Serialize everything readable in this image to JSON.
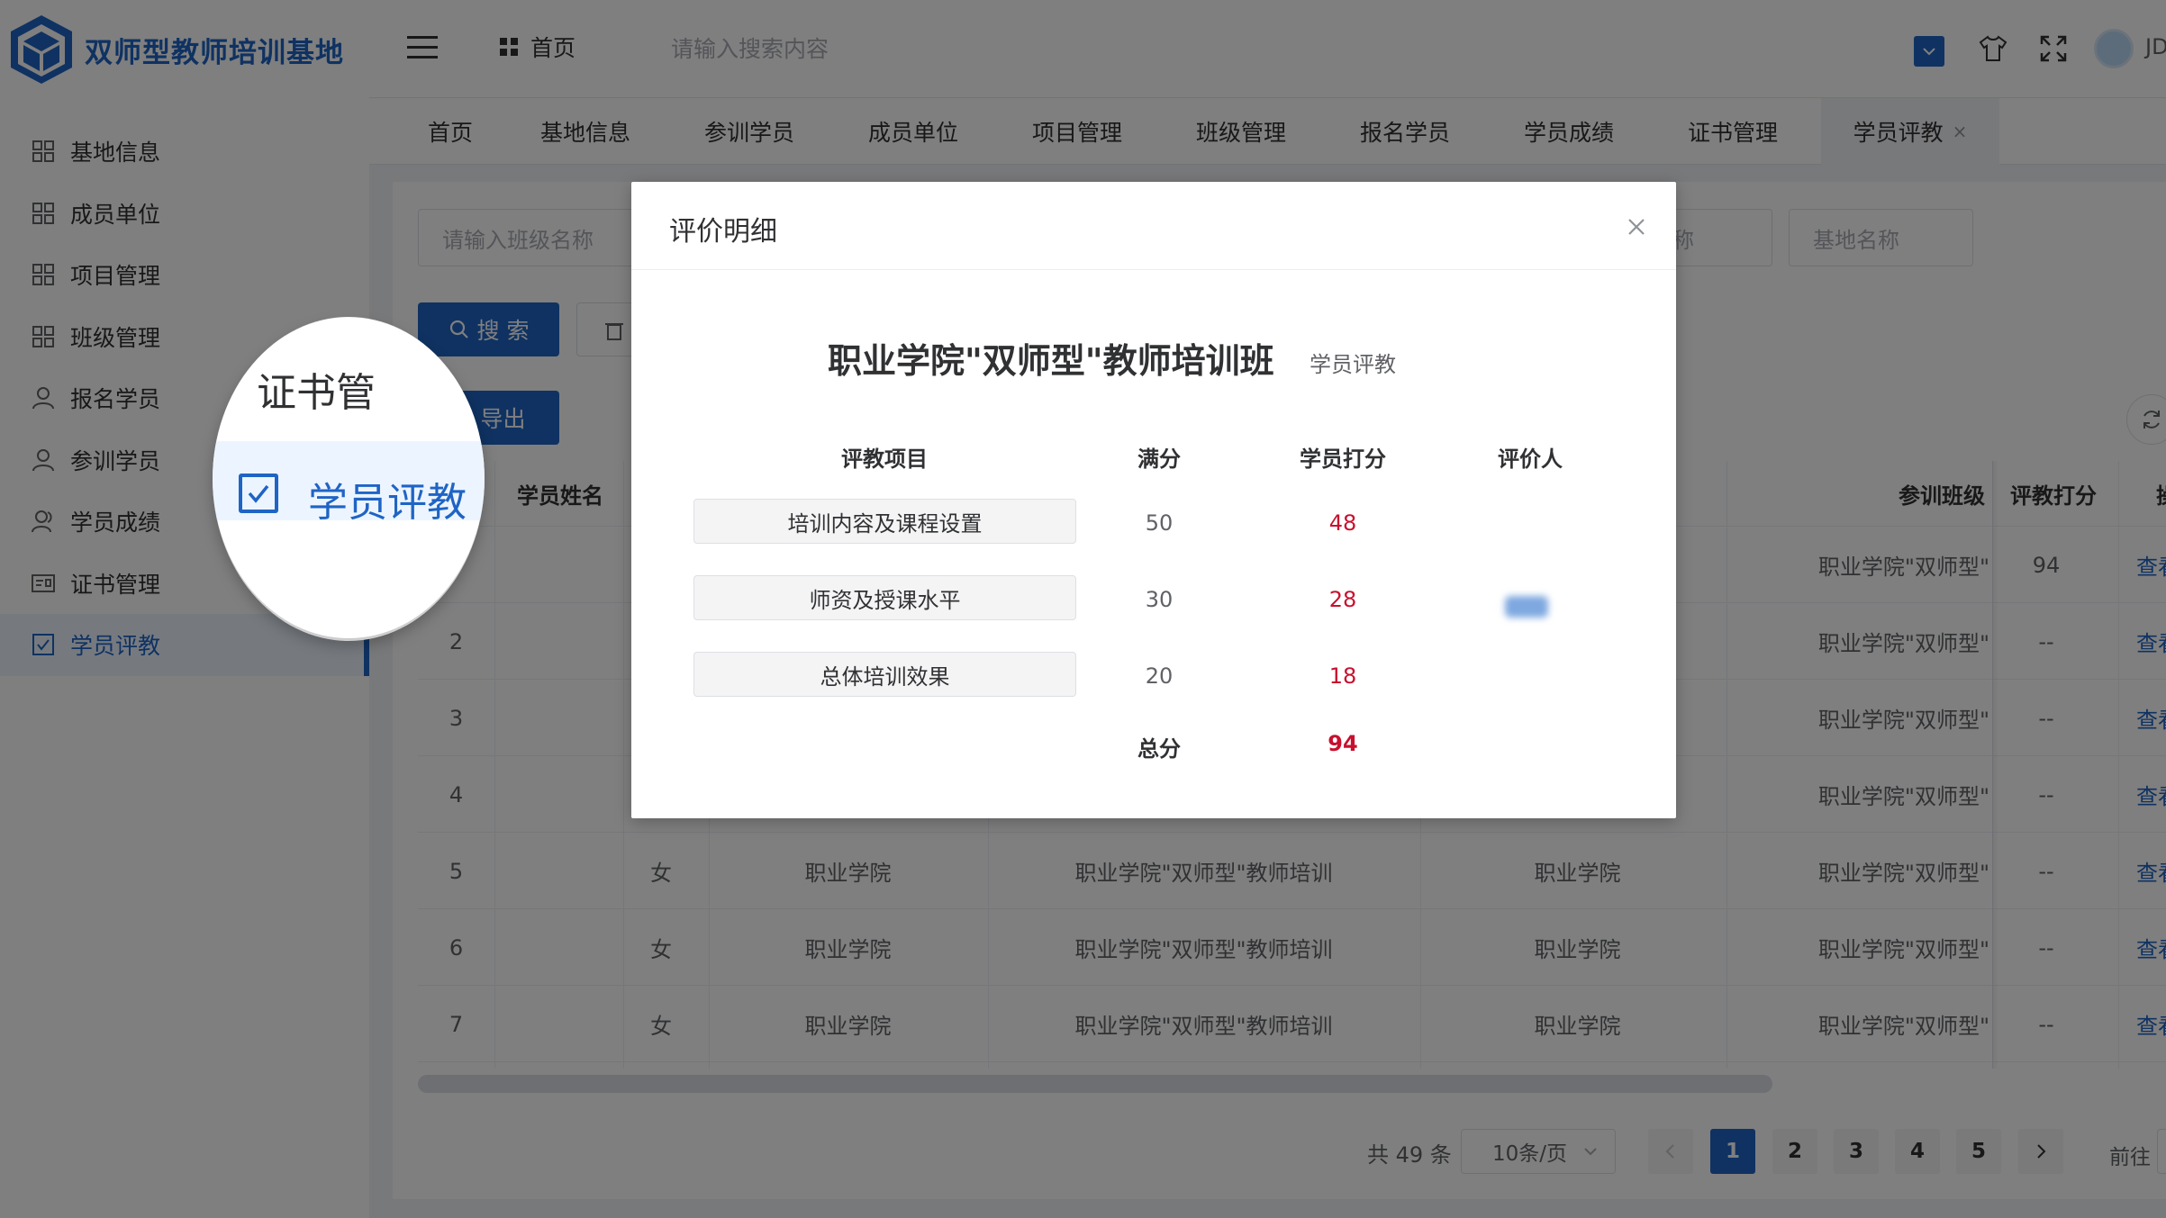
{
  "brand": {
    "title": "双师型教师培训基地"
  },
  "colors": {
    "primary": "#1f64c5",
    "score_red": "#c8102e"
  },
  "sidebar": {
    "items": [
      {
        "label": "基地信息",
        "icon": "grid-icon"
      },
      {
        "label": "成员单位",
        "icon": "grid-icon"
      },
      {
        "label": "项目管理",
        "icon": "grid-icon"
      },
      {
        "label": "班级管理",
        "icon": "grid-icon"
      },
      {
        "label": "报名学员",
        "icon": "user-icon"
      },
      {
        "label": "参训学员",
        "icon": "user-icon"
      },
      {
        "label": "学员成绩",
        "icon": "users-icon"
      },
      {
        "label": "证书管理",
        "icon": "certificate-icon"
      },
      {
        "label": "学员评教",
        "icon": "checkbox-icon",
        "active": true
      }
    ]
  },
  "header": {
    "home_label": "首页",
    "search_placeholder": "请输入搜索内容",
    "user_label": "JD"
  },
  "tabs": [
    {
      "label": "首页"
    },
    {
      "label": "基地信息"
    },
    {
      "label": "参训学员"
    },
    {
      "label": "成员单位"
    },
    {
      "label": "项目管理"
    },
    {
      "label": "班级管理"
    },
    {
      "label": "报名学员"
    },
    {
      "label": "学员成绩"
    },
    {
      "label": "证书管理"
    },
    {
      "label": "学员评教",
      "active": true,
      "close": "×"
    }
  ],
  "filters": {
    "class_placeholder": "请输入班级名称",
    "name_placeholder_partial": "称",
    "base_placeholder": "基地名称"
  },
  "toolbar": {
    "search_label": "搜 索",
    "export_label": "导出"
  },
  "table": {
    "headers": {
      "student_name": "学员姓名",
      "class": "参训班级",
      "score": "评教打分",
      "action_partial": "操"
    },
    "rows": [
      {
        "index": "",
        "gender": "",
        "unit": "",
        "project": "",
        "base": "",
        "class": "职业学院\"双师型\"",
        "score": "94",
        "action": "查看"
      },
      {
        "index": "2",
        "gender": "",
        "unit": "",
        "project": "",
        "base": "",
        "class": "职业学院\"双师型\"",
        "score": "--",
        "action": "查看"
      },
      {
        "index": "3",
        "gender": "",
        "unit": "",
        "project": "",
        "base": "",
        "class": "职业学院\"双师型\"",
        "score": "--",
        "action": "查看"
      },
      {
        "index": "4",
        "gender": "",
        "unit": "",
        "project": "",
        "base": "",
        "class": "职业学院\"双师型\"",
        "score": "--",
        "action": "查看"
      },
      {
        "index": "5",
        "gender": "女",
        "unit": "职业学院",
        "project": "职业学院\"双师型\"教师培训",
        "base": "职业学院",
        "class": "职业学院\"双师型\"",
        "score": "--",
        "action": "查看"
      },
      {
        "index": "6",
        "gender": "女",
        "unit": "职业学院",
        "project": "职业学院\"双师型\"教师培训",
        "base": "职业学院",
        "class": "职业学院\"双师型\"",
        "score": "--",
        "action": "查看"
      },
      {
        "index": "7",
        "gender": "女",
        "unit": "职业学院",
        "project": "职业学院\"双师型\"教师培训",
        "base": "职业学院",
        "class": "职业学院\"双师型\"",
        "score": "--",
        "action": "查看"
      }
    ]
  },
  "pagination": {
    "total": "共 49 条",
    "page_size": "10条/页",
    "pages": [
      "1",
      "2",
      "3",
      "4",
      "5"
    ],
    "current": "1",
    "goto": "前往"
  },
  "magnifier": {
    "cert_label": "证书管",
    "active_label": "学员评教"
  },
  "dialog": {
    "title": "评价明细",
    "heading": "职业学院\"双师型\"教师培训班",
    "subheading": "学员评教",
    "columns": {
      "item": "评教项目",
      "full": "满分",
      "score": "学员打分",
      "rater": "评价人"
    },
    "rows": [
      {
        "item": "培训内容及课程设置",
        "full": "50",
        "score": "48"
      },
      {
        "item": "师资及授课水平",
        "full": "30",
        "score": "28"
      },
      {
        "item": "总体培训效果",
        "full": "20",
        "score": "18"
      }
    ],
    "total_label": "总分",
    "total_value": "94"
  }
}
